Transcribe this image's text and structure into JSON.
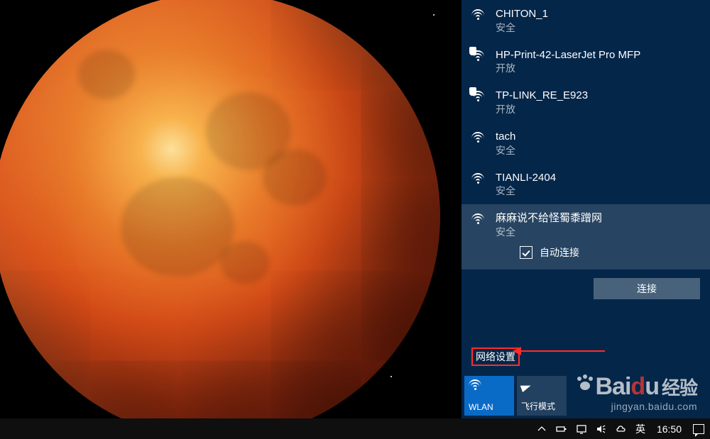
{
  "networks": [
    {
      "name": "CHITON_1",
      "status": "安全",
      "badge": false
    },
    {
      "name": "HP-Print-42-LaserJet Pro MFP",
      "status": "开放",
      "badge": true
    },
    {
      "name": "TP-LINK_RE_E923",
      "status": "开放",
      "badge": true
    },
    {
      "name": "tach",
      "status": "安全",
      "badge": false
    },
    {
      "name": "TIANLI-2404",
      "status": "安全",
      "badge": false
    }
  ],
  "selected_network": {
    "name": "麻麻说不给怪蜀黍蹭网",
    "status": "安全",
    "auto_connect_label": "自动连接",
    "connect_label": "连接"
  },
  "footer": {
    "settings_label": "网络设置"
  },
  "quick_actions": {
    "wlan": "WLAN",
    "airplane": "飞行模式"
  },
  "taskbar": {
    "lang": "英",
    "time": "16:50"
  },
  "watermark": {
    "brand_prefix": "Bai",
    "brand_accent": "d",
    "brand_suffix": "u",
    "brand_cn": "经验",
    "url": "jingyan.baidu.com"
  }
}
